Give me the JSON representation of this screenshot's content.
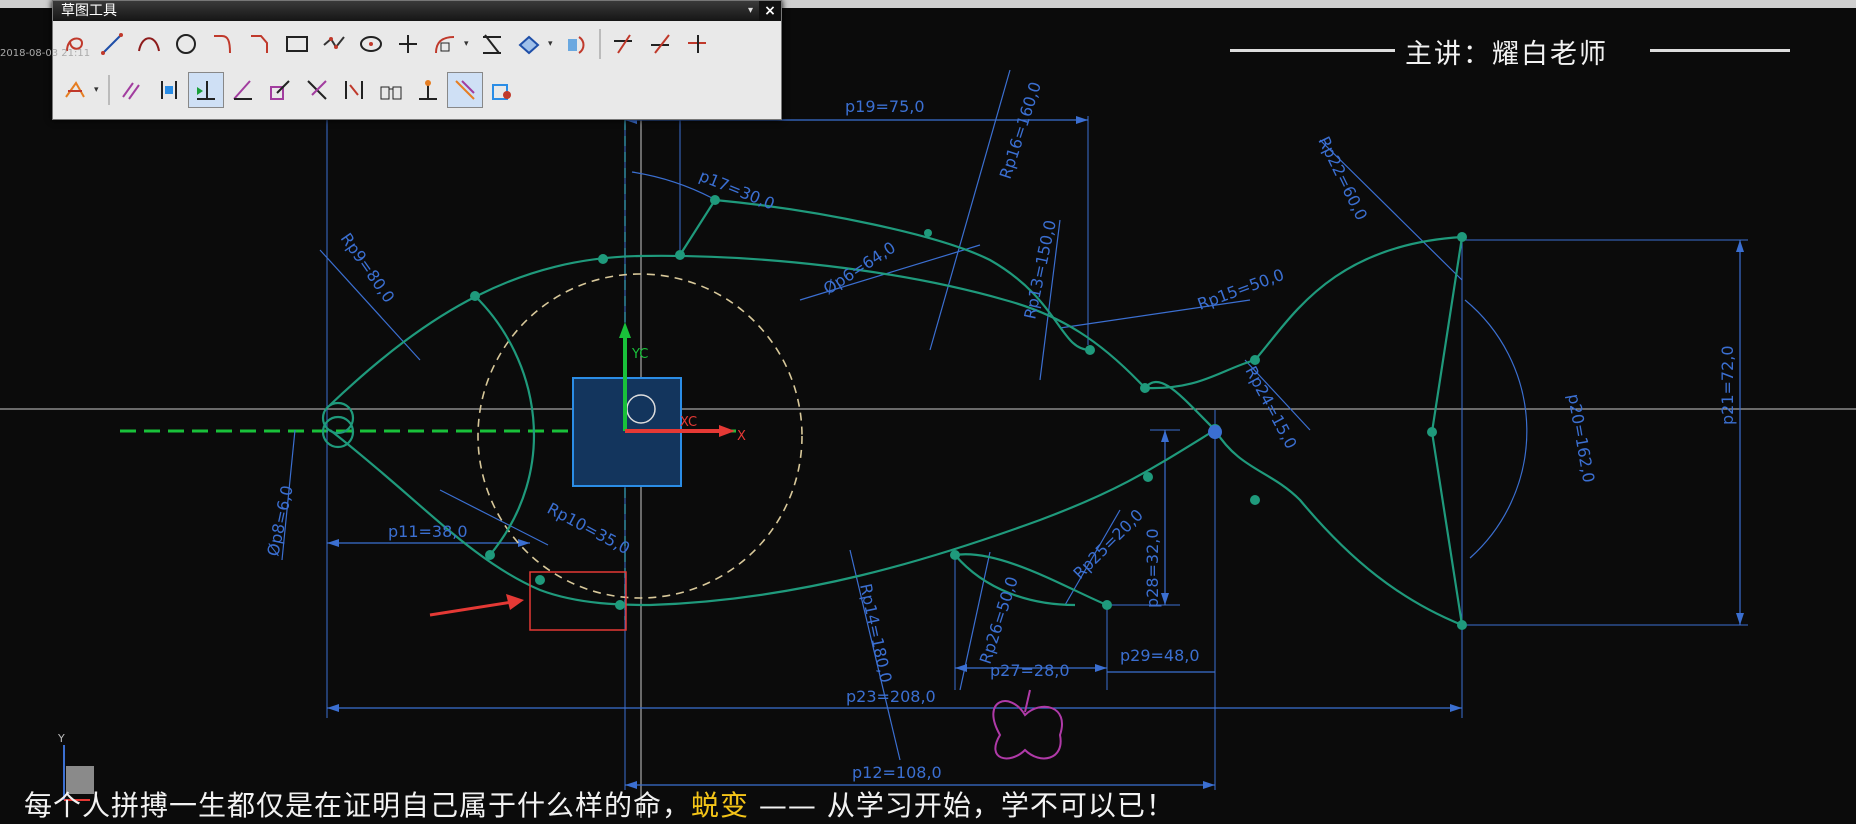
{
  "toolbar": {
    "title": "草图工具",
    "close": "×",
    "row1": [
      "profile-icon",
      "line-icon",
      "arc-icon",
      "circle-icon",
      "fillet-icon",
      "chamfer-icon",
      "rectangle-icon",
      "polygon-icon",
      "ellipse-icon",
      "point-icon",
      "offset-curve-icon",
      "trim-corner-icon",
      "mirror-curve-icon",
      "pattern-curve-icon",
      "quick-trim-icon",
      "quick-extend-icon",
      "make-corner-icon"
    ],
    "row2": [
      "auto-dimension-icon",
      "geometric-constraint-icon",
      "show-constraints-icon",
      "continuous-auto-dimension-icon",
      "convert-reference-icon",
      "animate-dimension-icon",
      "alternate-solution-icon",
      "inferred-constraints-icon",
      "display-sketch-constraints-icon",
      "create-inferred-icon",
      "relax-dimension-icon"
    ]
  },
  "header": {
    "lecturer": "主讲：耀白老师",
    "date": "2018-08-03 21:11"
  },
  "subtitle": {
    "before": "每个人拼搏一生都仅是在证明自己属于什么样的命，",
    "highlight": "蜕变",
    "after": " —— 从学习开始，学不可以已！"
  },
  "axes": {
    "yc": "YC",
    "xc": "XC",
    "x": "X",
    "y": "Y"
  },
  "dimensions": [
    {
      "id": "p19",
      "text": "p19=75,0"
    },
    {
      "id": "p16",
      "text": "Rp16=160,0"
    },
    {
      "id": "p22",
      "text": "Rp22=60,0"
    },
    {
      "id": "p17",
      "text": "p17=30,0"
    },
    {
      "id": "p9",
      "text": "Rp9=80,0"
    },
    {
      "id": "p6",
      "text": "Øp6=64,0"
    },
    {
      "id": "p13",
      "text": "Rp13=150,0"
    },
    {
      "id": "p15",
      "text": "Rp15=50,0"
    },
    {
      "id": "p21",
      "text": "p21=72,0"
    },
    {
      "id": "p20",
      "text": "p20=162,0"
    },
    {
      "id": "p24",
      "text": "Rp24=15,0"
    },
    {
      "id": "p8",
      "text": "Øp8=6,0"
    },
    {
      "id": "p11",
      "text": "p11=38,0"
    },
    {
      "id": "p10",
      "text": "Rp10=35,0"
    },
    {
      "id": "p25",
      "text": "Rp25=20,0"
    },
    {
      "id": "p28",
      "text": "p28=32,0"
    },
    {
      "id": "p14",
      "text": "Rp14=180,0"
    },
    {
      "id": "p26",
      "text": "Rp26=50,0"
    },
    {
      "id": "p27",
      "text": "p27=28,0"
    },
    {
      "id": "p29",
      "text": "p29=48,0"
    },
    {
      "id": "p23",
      "text": "p23=208,0"
    },
    {
      "id": "p12",
      "text": "p12=108,0"
    }
  ],
  "colors": {
    "curve": "#1f9a7c",
    "dimension": "#3b6fd1",
    "green-axis": "#19c13a",
    "reference-circle": "#d8c89a",
    "annotation": "#e53935"
  }
}
